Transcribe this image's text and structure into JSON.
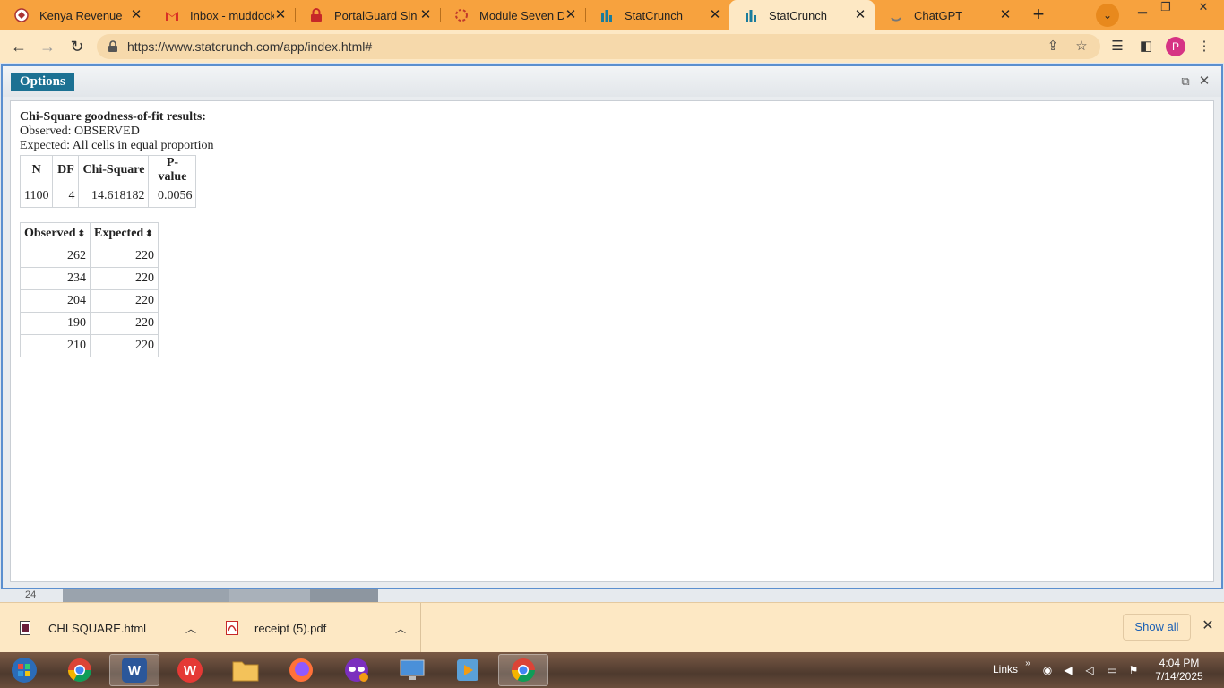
{
  "browser": {
    "tabs": [
      {
        "title": "Kenya Revenue Au",
        "icon": "kra-icon",
        "active": false
      },
      {
        "title": "Inbox - muddockm",
        "icon": "gmail-icon",
        "active": false
      },
      {
        "title": "PortalGuard Single",
        "icon": "portalguard-icon",
        "active": false
      },
      {
        "title": "Module Seven Dis",
        "icon": "module-icon",
        "active": false
      },
      {
        "title": "StatCrunch",
        "icon": "statcrunch-icon",
        "active": false
      },
      {
        "title": "StatCrunch",
        "icon": "statcrunch-icon",
        "active": true
      },
      {
        "title": "ChatGPT",
        "icon": "loading-icon",
        "active": false
      }
    ],
    "url": "https://www.statcrunch.com/app/index.html#",
    "profile_initial": "P"
  },
  "dialog": {
    "options_label": "Options",
    "heading": "Chi-Square goodness-of-fit results:",
    "observed_line": "Observed: OBSERVED",
    "expected_line": "Expected: All cells in equal proportion",
    "summary_headers": [
      "N",
      "DF",
      "Chi-Square",
      "P-value"
    ],
    "summary_row": [
      "1100",
      "4",
      "14.618182",
      "0.0056"
    ],
    "cells_headers": [
      "Observed",
      "Expected"
    ],
    "cells_rows": [
      [
        "262",
        "220"
      ],
      [
        "234",
        "220"
      ],
      [
        "204",
        "220"
      ],
      [
        "190",
        "220"
      ],
      [
        "210",
        "220"
      ]
    ]
  },
  "sheet_row_number": "24",
  "downloads": {
    "items": [
      {
        "name": "CHI SQUARE.html"
      },
      {
        "name": "receipt (5).pdf"
      }
    ],
    "show_all_label": "Show all"
  },
  "taskbar": {
    "links_label": "Links",
    "time": "4:04 PM",
    "date": "7/14/2025"
  },
  "colors": {
    "tab_strip": "#f7a23e",
    "toolbar": "#fde8c4",
    "options_button": "#1c7193",
    "dialog_border": "#5b8fcf"
  }
}
